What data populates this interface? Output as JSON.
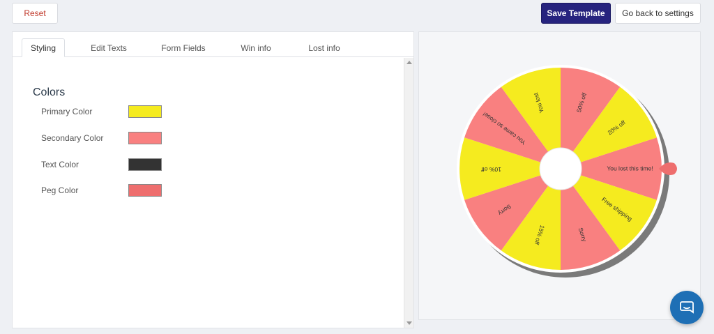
{
  "toolbar": {
    "reset_label": "Reset",
    "save_label": "Save Template",
    "back_label": "Go back to settings"
  },
  "tabs": [
    {
      "label": "Styling"
    },
    {
      "label": "Edit Texts"
    },
    {
      "label": "Form Fields"
    },
    {
      "label": "Win info"
    },
    {
      "label": "Lost info"
    }
  ],
  "colors": {
    "title": "Colors",
    "items": [
      {
        "label": "Primary Color",
        "value": "#f5eb1f"
      },
      {
        "label": "Secondary Color",
        "value": "#f98080"
      },
      {
        "label": "Text Color",
        "value": "#333333"
      },
      {
        "label": "Peg Color",
        "value": "#ee6e6e"
      }
    ]
  },
  "wheel": {
    "segments": [
      {
        "label": "You lost this time!"
      },
      {
        "label": "Free shipping"
      },
      {
        "label": "Sorry"
      },
      {
        "label": "15% off"
      },
      {
        "label": "Sorry"
      },
      {
        "label": "10% off"
      },
      {
        "label": "You came so close!"
      },
      {
        "label": "You lost"
      },
      {
        "label": "50% off"
      },
      {
        "label": "20% off"
      }
    ],
    "primary_color": "#f5eb1f",
    "secondary_color": "#f98080",
    "text_color": "#333333",
    "peg_color": "#ee6e6e"
  },
  "chat": {
    "icon": "chat-bubble-icon",
    "color": "#1e6fb5"
  }
}
